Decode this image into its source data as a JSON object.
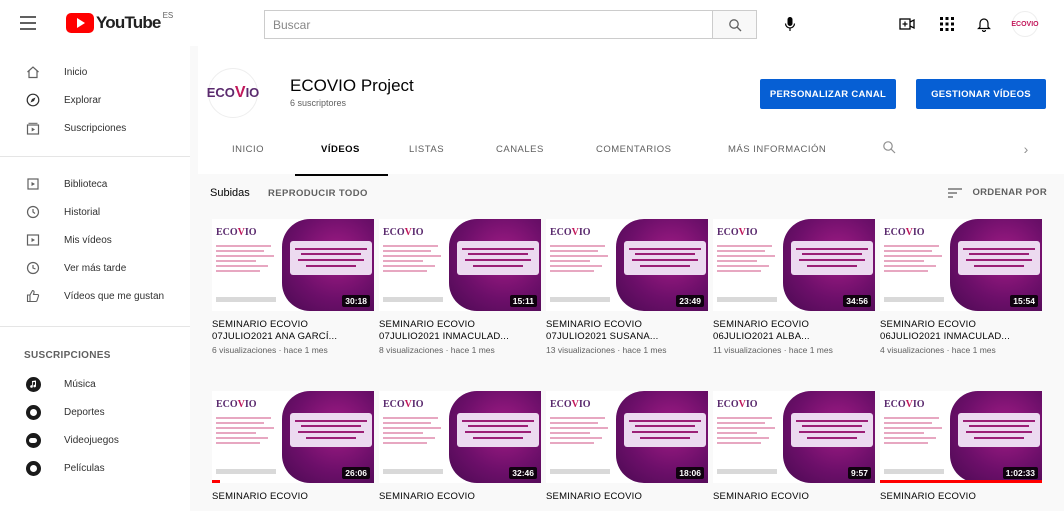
{
  "header": {
    "logo_text": "YouTube",
    "logo_country": "ES",
    "search_placeholder": "Buscar",
    "avatar_text": "ECOVIO",
    "icons": [
      "menu-icon",
      "search-icon",
      "mic-icon",
      "create-video-icon",
      "apps-icon",
      "bell-icon"
    ]
  },
  "sidebar": {
    "main": [
      {
        "label": "Inicio",
        "icon": "home-icon"
      },
      {
        "label": "Explorar",
        "icon": "compass-icon"
      },
      {
        "label": "Suscripciones",
        "icon": "subscriptions-icon"
      }
    ],
    "library": [
      {
        "label": "Biblioteca",
        "icon": "library-icon"
      },
      {
        "label": "Historial",
        "icon": "history-icon"
      },
      {
        "label": "Mis vídeos",
        "icon": "my-videos-icon"
      },
      {
        "label": "Ver más tarde",
        "icon": "watch-later-icon"
      },
      {
        "label": "Vídeos que me gustan",
        "icon": "like-icon"
      }
    ],
    "subscriptions_heading": "SUSCRIPCIONES",
    "subscriptions": [
      {
        "label": "Música"
      },
      {
        "label": "Deportes"
      },
      {
        "label": "Videojuegos"
      },
      {
        "label": "Películas"
      }
    ]
  },
  "channel": {
    "avatar_text_a": "ECO",
    "avatar_text_v": "V",
    "avatar_text_b": "IO",
    "name": "ECOVIO Project",
    "subscribers": "6 suscriptores",
    "customize_label": "PERSONALIZAR CANAL",
    "manage_label": "GESTIONAR VÍDEOS",
    "tabs": [
      "INICIO",
      "VÍDEOS",
      "LISTAS",
      "CANALES",
      "COMENTARIOS",
      "MÁS INFORMACIÓN"
    ],
    "active_tab": "VÍDEOS"
  },
  "section": {
    "title": "Subidas",
    "play_all": "REPRODUCIR TODO",
    "sort": "ORDENAR POR"
  },
  "videos": [
    {
      "title1": "SEMINARIO ECOVIO",
      "title2": "07JULIO2021 ANA GARCÍ...",
      "meta": "6 visualizaciones · hace 1 mes",
      "duration": "30:18",
      "progress": 0.0
    },
    {
      "title1": "SEMINARIO ECOVIO",
      "title2": "07JULIO2021 INMACULAD...",
      "meta": "8 visualizaciones · hace 1 mes",
      "duration": "15:11",
      "progress": 0.0
    },
    {
      "title1": "SEMINARIO ECOVIO",
      "title2": "07JULIO2021 SUSANA...",
      "meta": "13 visualizaciones · hace 1 mes",
      "duration": "23:49",
      "progress": 0.0
    },
    {
      "title1": "SEMINARIO ECOVIO",
      "title2": "06JULIO2021 ALBA...",
      "meta": "11 visualizaciones · hace 1 mes",
      "duration": "34:56",
      "progress": 0.0
    },
    {
      "title1": "SEMINARIO ECOVIO",
      "title2": "06JULIO2021 INMACULAD...",
      "meta": "4 visualizaciones · hace 1 mes",
      "duration": "15:54",
      "progress": 0.0
    },
    {
      "title1": "SEMINARIO ECOVIO",
      "title2": "",
      "meta": "",
      "duration": "26:06",
      "progress": 0.05
    },
    {
      "title1": "SEMINARIO ECOVIO",
      "title2": "",
      "meta": "",
      "duration": "32:46",
      "progress": 0.0
    },
    {
      "title1": "SEMINARIO ECOVIO",
      "title2": "",
      "meta": "",
      "duration": "18:06",
      "progress": 0.0
    },
    {
      "title1": "SEMINARIO ECOVIO",
      "title2": "",
      "meta": "",
      "duration": "9:57",
      "progress": 0.0
    },
    {
      "title1": "SEMINARIO ECOVIO",
      "title2": "",
      "meta": "",
      "duration": "1:02:33",
      "progress": 1.0
    }
  ],
  "colors": {
    "accent_blue": "#065fd4",
    "brand_red": "#ff0000",
    "thumb_purple": "#7a1370"
  }
}
